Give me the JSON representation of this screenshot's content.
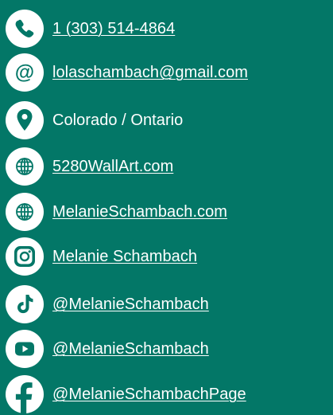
{
  "colors": {
    "background": "#037767",
    "icon_fill": "#ffffff",
    "icon_glyph": "#037767",
    "text": "#ffffff"
  },
  "contacts": [
    {
      "icon": "phone-icon",
      "text": "1 (303) 514-4864",
      "is_link": true
    },
    {
      "icon": "at-sign-icon",
      "text": "lolaschambach@gmail.com",
      "is_link": true
    },
    {
      "icon": "location-pin-icon",
      "text": "Colorado / Ontario",
      "is_link": false
    },
    {
      "icon": "globe-icon",
      "text": "5280WallArt.com",
      "is_link": true
    },
    {
      "icon": "globe-icon",
      "text": "MelanieSchambach.com",
      "is_link": true
    },
    {
      "icon": "instagram-icon",
      "text": "Melanie Schambach",
      "is_link": true
    },
    {
      "icon": "tiktok-icon",
      "text": "@MelanieSchambach",
      "is_link": true
    },
    {
      "icon": "youtube-icon",
      "text": "@MelanieSchambach",
      "is_link": true
    },
    {
      "icon": "facebook-icon",
      "text": "@MelanieSchambachPage",
      "is_link": true
    }
  ]
}
